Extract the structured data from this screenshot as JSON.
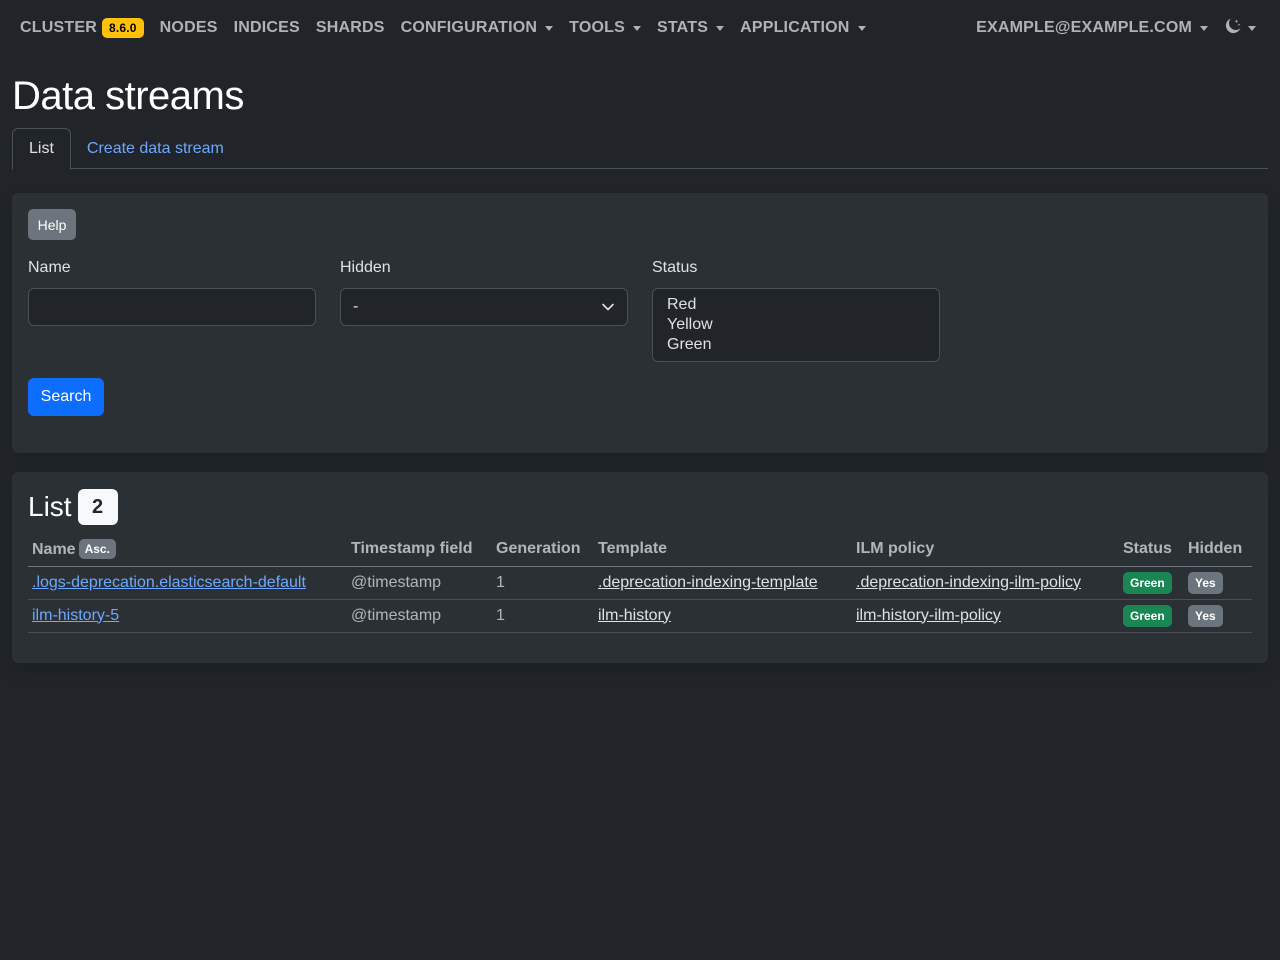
{
  "navbar": {
    "brand": "CLUSTER",
    "version": "8.6.0",
    "items": [
      {
        "label": "NODES",
        "dropdown": false
      },
      {
        "label": "INDICES",
        "dropdown": false
      },
      {
        "label": "SHARDS",
        "dropdown": false
      },
      {
        "label": "CONFIGURATION",
        "dropdown": true
      },
      {
        "label": "TOOLS",
        "dropdown": true
      },
      {
        "label": "STATS",
        "dropdown": true
      },
      {
        "label": "APPLICATION",
        "dropdown": true
      }
    ],
    "user": "EXAMPLE@EXAMPLE.COM",
    "theme_icon": "moon-stars-icon"
  },
  "page": {
    "title": "Data streams"
  },
  "tabs": [
    {
      "label": "List",
      "active": true
    },
    {
      "label": "Create data stream",
      "active": false
    }
  ],
  "filters": {
    "help_label": "Help",
    "name_label": "Name",
    "name_value": "",
    "hidden_label": "Hidden",
    "hidden_value": "-",
    "status_label": "Status",
    "status_options": [
      "Red",
      "Yellow",
      "Green"
    ],
    "search_label": "Search"
  },
  "list": {
    "title": "List",
    "count": "2",
    "columns": {
      "name": "Name",
      "sort": "Asc.",
      "timestamp": "Timestamp field",
      "generation": "Generation",
      "template": "Template",
      "ilm": "ILM policy",
      "status": "Status",
      "hidden": "Hidden"
    },
    "rows": [
      {
        "name": ".logs-deprecation.elasticsearch-default",
        "timestamp": "@timestamp",
        "generation": "1",
        "template": ".deprecation-indexing-template",
        "ilm": ".deprecation-indexing-ilm-policy",
        "status": "Green",
        "hidden": "Yes"
      },
      {
        "name": "ilm-history-5",
        "timestamp": "@timestamp",
        "generation": "1",
        "template": "ilm-history",
        "ilm": "ilm-history-ilm-policy",
        "status": "Green",
        "hidden": "Yes"
      }
    ]
  },
  "colors": {
    "background": "#212529",
    "card": "#2b3035",
    "primary": "#0d6efd",
    "link": "#6ea8fe",
    "version_badge": "#ffc107",
    "status_green": "#198754",
    "secondary": "#6c757d"
  }
}
